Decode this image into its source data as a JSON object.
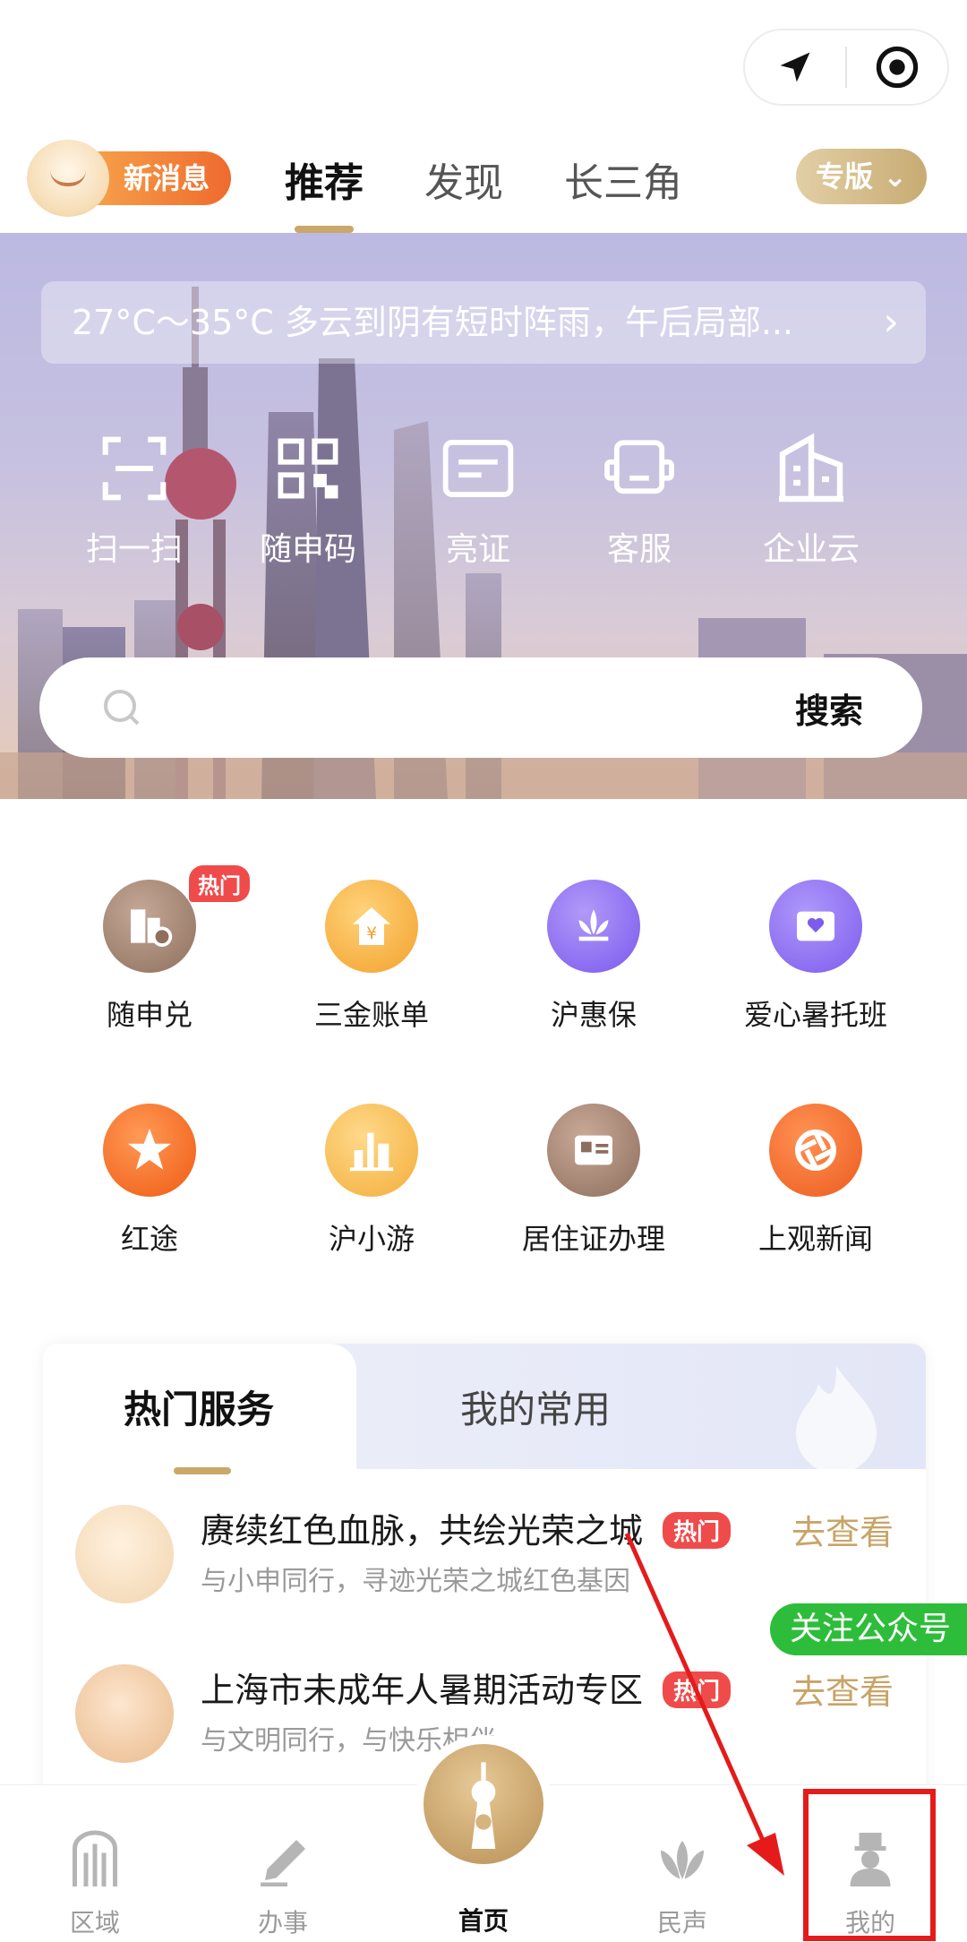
{
  "capsule": {
    "location_icon": "navigation-arrow-icon",
    "target_icon": "target-icon"
  },
  "header": {
    "new_message": "新消息",
    "tabs": [
      {
        "label": "推荐",
        "active": true
      },
      {
        "label": "发现",
        "active": false
      },
      {
        "label": "长三角",
        "active": false
      }
    ],
    "edition": "专版",
    "edition_chevron": "⌄"
  },
  "hero": {
    "weather": "27°C～35°C 多云到阴有短时阵雨，午后局部...",
    "weather_chevron": "›",
    "quick_actions": [
      {
        "label": "扫一扫",
        "icon": "scan-icon"
      },
      {
        "label": "随申码",
        "icon": "qr-code-icon"
      },
      {
        "label": "亮证",
        "icon": "id-card-icon"
      },
      {
        "label": "客服",
        "icon": "headset-icon"
      },
      {
        "label": "企业云",
        "icon": "building-icon"
      }
    ],
    "search_button": "搜索"
  },
  "grid": [
    [
      {
        "label": "随申兑",
        "badge": "热门",
        "color": "#9a7a66"
      },
      {
        "label": "三金账单",
        "color": "#f6b23c"
      },
      {
        "label": "沪惠保",
        "color": "#8a6cf2"
      },
      {
        "label": "爱心暑托班",
        "color": "#8f6df0"
      }
    ],
    [
      {
        "label": "红途",
        "color": "#f76a1c"
      },
      {
        "label": "沪小游",
        "color": "#f6b94a"
      },
      {
        "label": "居住证办理",
        "color": "#a07d68"
      },
      {
        "label": "上观新闻",
        "color": "#f2672a"
      }
    ]
  ],
  "services": {
    "tabs": [
      "热门服务",
      "我的常用"
    ],
    "items": [
      {
        "title": "赓续红色血脉，共绘光荣之城",
        "subtitle": "与小申同行，寻迹光荣之城红色基因",
        "badge": "热门",
        "action": "去查看"
      },
      {
        "title": "上海市未成年人暑期活动专区",
        "subtitle": "与文明同行，与快乐相伴",
        "badge": "热门",
        "action": "去查看"
      }
    ]
  },
  "follow_tag": "关注公众号",
  "tabbar": [
    {
      "label": "区域",
      "icon": "arch-icon"
    },
    {
      "label": "办事",
      "icon": "pen-icon"
    },
    {
      "label": "首页",
      "icon": "tower-icon",
      "active": true
    },
    {
      "label": "民声",
      "icon": "flower-icon"
    },
    {
      "label": "我的",
      "icon": "person-icon"
    }
  ],
  "colors": {
    "accent_gold": "#c9a86a",
    "hot_red": "#f04b4b",
    "follow_green": "#2dbd3a",
    "annotation_red": "#e51b1b"
  }
}
